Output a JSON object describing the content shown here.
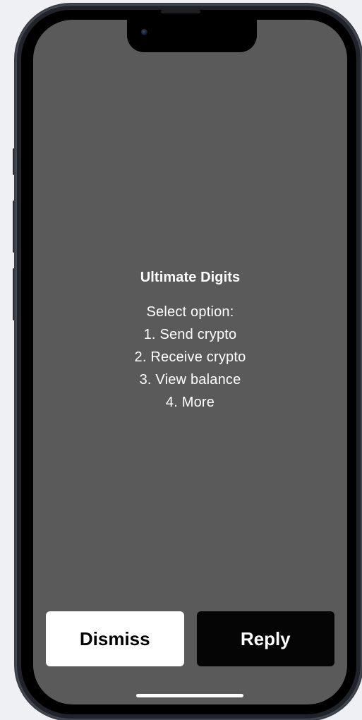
{
  "dialog": {
    "title": "Ultimate Digits",
    "lines": [
      "Select option:",
      "1. Send crypto",
      "2. Receive crypto",
      "3. View balance",
      "4. More"
    ]
  },
  "actions": {
    "dismiss_label": "Dismiss",
    "reply_label": "Reply"
  },
  "colors": {
    "screen_background": "#5a5a5a",
    "dismiss_background": "#ffffff",
    "reply_background": "#050505",
    "page_background": "#eef0f4"
  }
}
